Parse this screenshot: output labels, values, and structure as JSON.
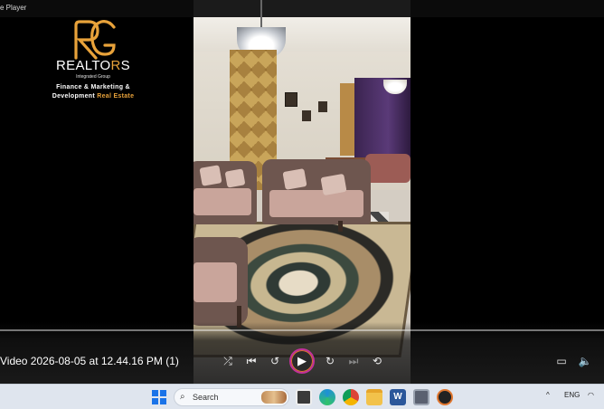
{
  "window": {
    "title": "Media Player",
    "title_visible": "e Player"
  },
  "logo": {
    "monogram": "RG",
    "brand_left": "REALTO",
    "brand_accent": "R",
    "brand_right": "S",
    "subtitle": "Integrated Group",
    "tagline_line1": "Finance & Marketing &",
    "tagline_line2_plain": "Development ",
    "tagline_line2_accent": "Real Estate"
  },
  "player": {
    "video_title": "Video 2026-08-05 at 12.44.16 PM (1)",
    "progress": 0.0,
    "controls": {
      "shuffle_icon": "⤮",
      "previous_icon": "⏮",
      "rewind_icon": "↺",
      "play_icon": "▶",
      "forward_icon": "↻",
      "next_icon": "⏭",
      "repeat_icon": "⟲",
      "miniplayer_icon": "▭",
      "volume_icon": "🔈"
    }
  },
  "taskbar": {
    "search_placeholder": "Search",
    "search_icon": "⌕",
    "language": "ENG",
    "chevron_icon": "^",
    "wifi_icon": "◠"
  },
  "colors": {
    "accent_orange": "#e8a23a",
    "play_ring": "#c2319a",
    "taskbar": "#dfe5ee"
  }
}
